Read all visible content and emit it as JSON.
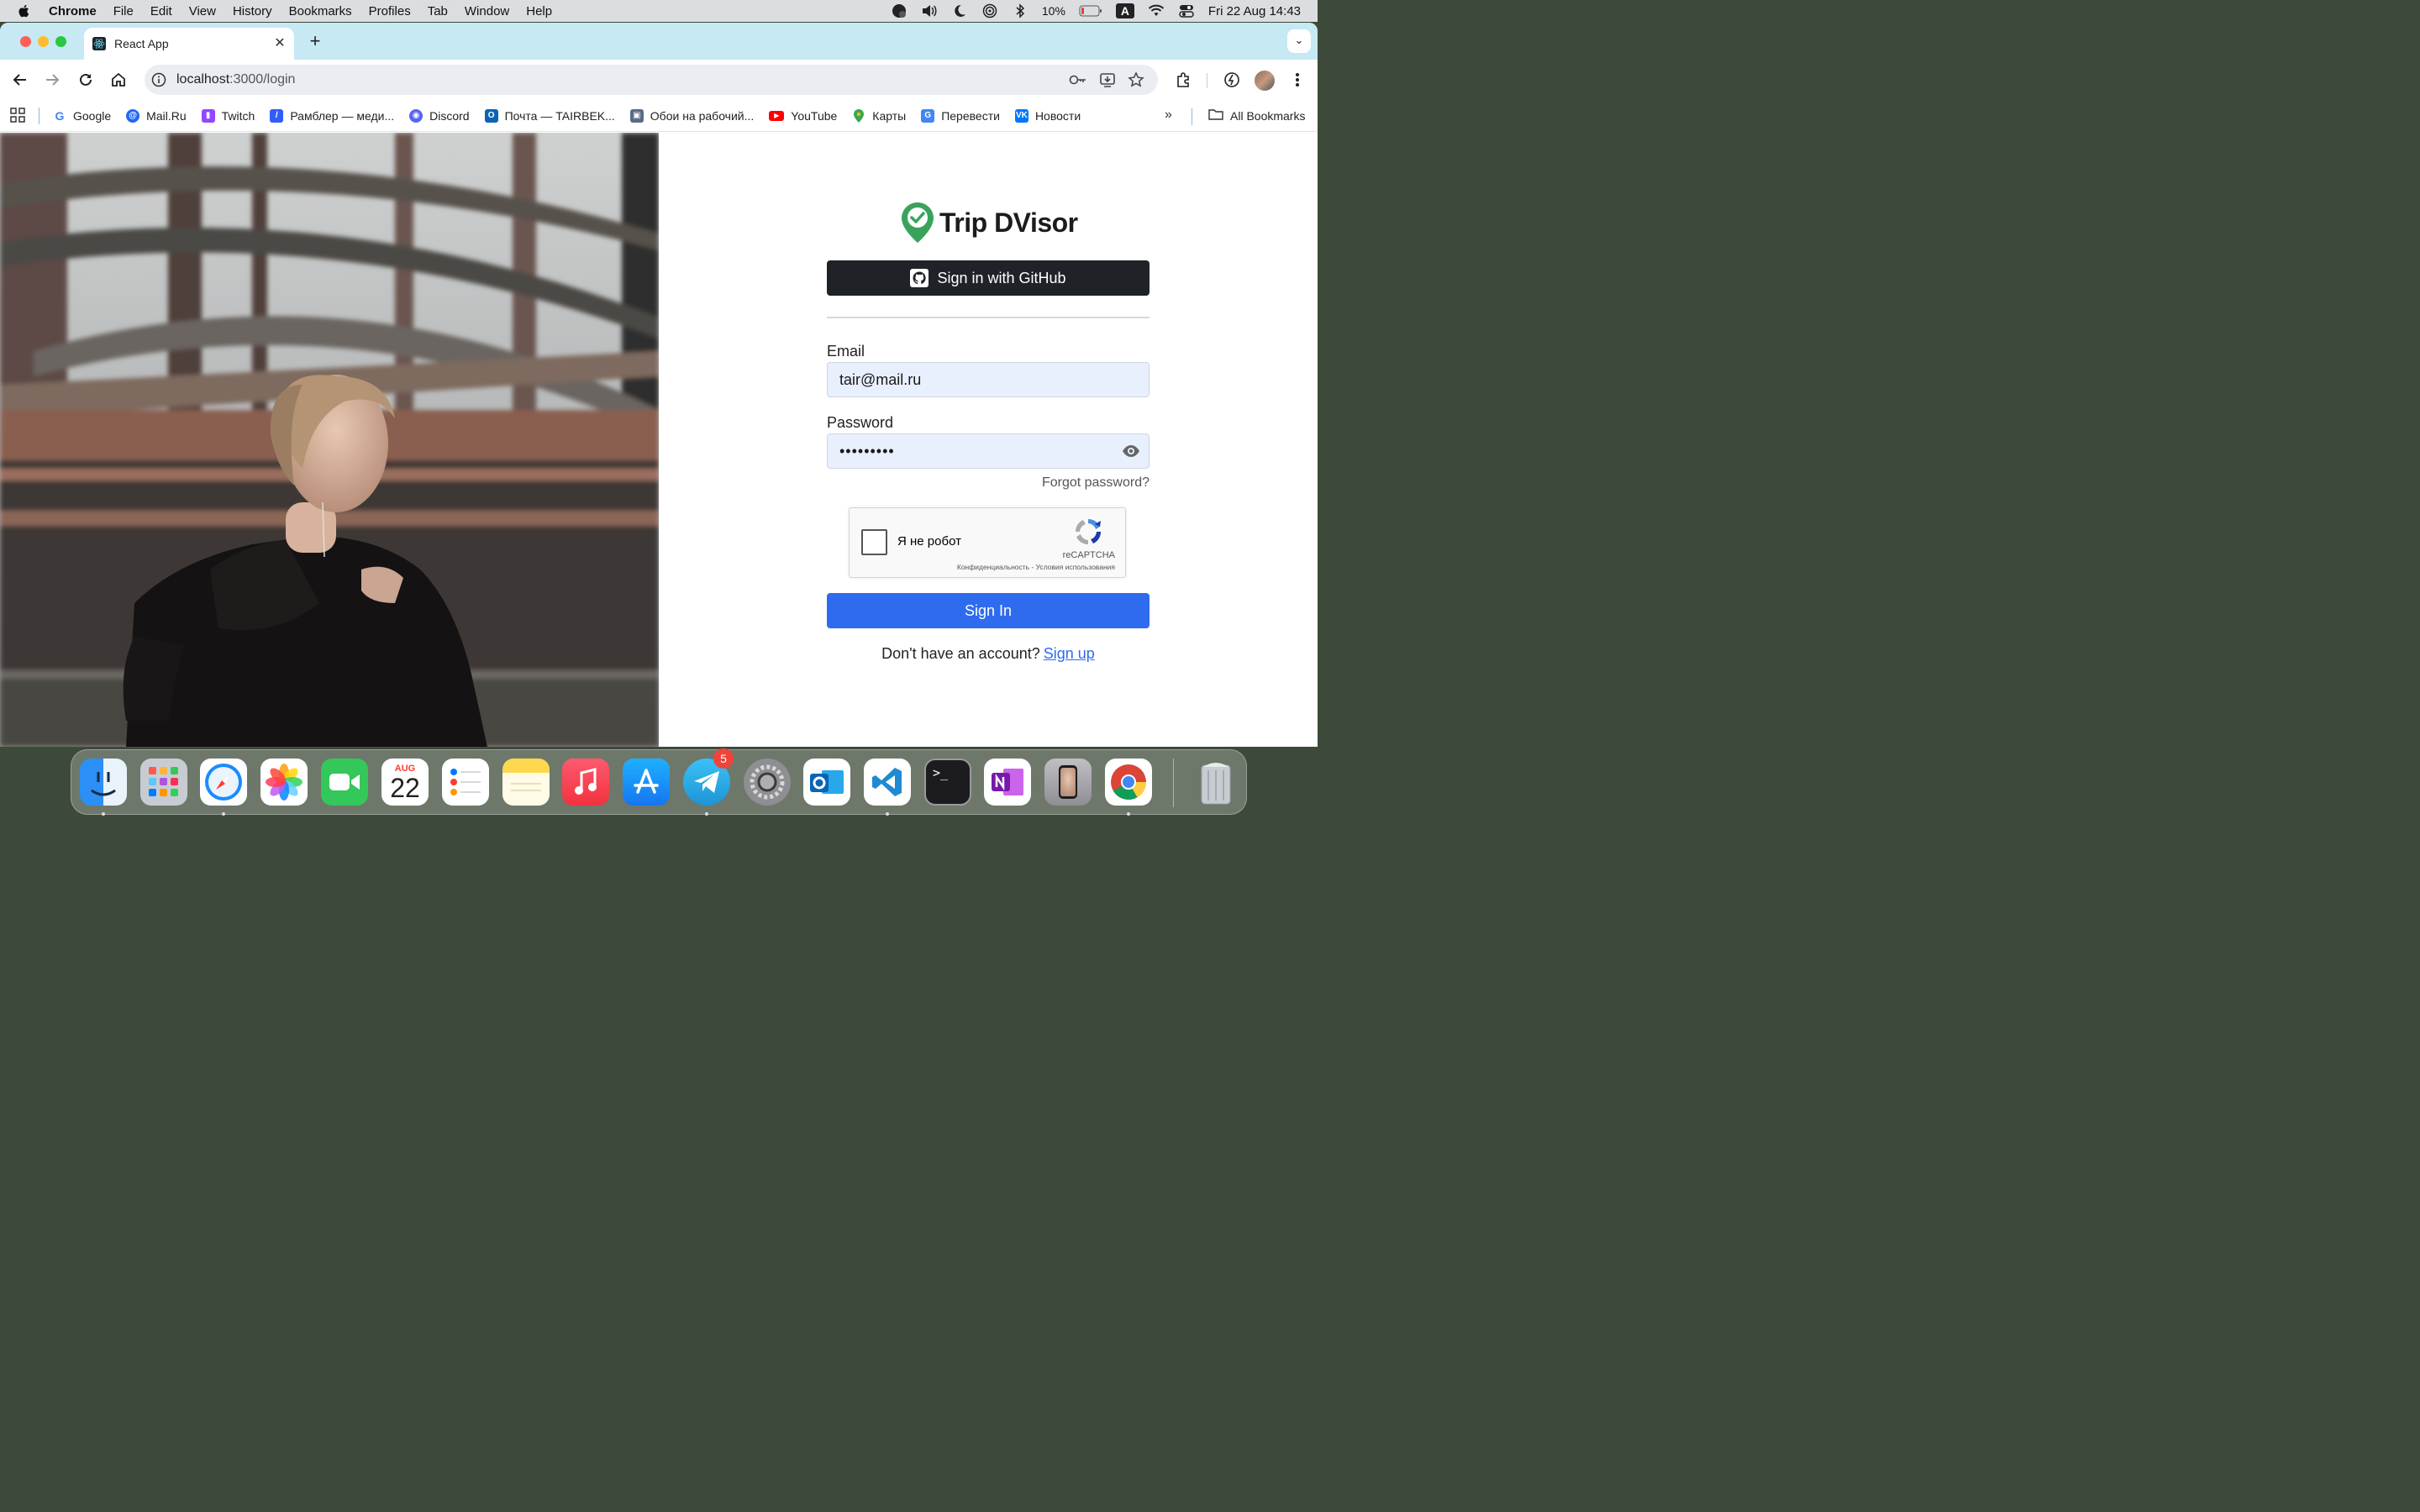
{
  "menubar": {
    "app_name": "Chrome",
    "items": [
      "File",
      "Edit",
      "View",
      "History",
      "Bookmarks",
      "Profiles",
      "Tab",
      "Window",
      "Help"
    ],
    "battery": "10%",
    "input_source": "A",
    "clock": "Fri 22 Aug  14:43"
  },
  "browser": {
    "tab_title": "React App",
    "url_host": "localhost",
    "url_path": ":3000/login",
    "bookmarks": [
      {
        "label": "Google",
        "icon": "google-icon",
        "color": "#4285f4"
      },
      {
        "label": "Mail.Ru",
        "icon": "mailru-icon",
        "color": "#2168f3"
      },
      {
        "label": "Twitch",
        "icon": "twitch-icon",
        "color": "#9146ff"
      },
      {
        "label": "Рамблер — меди...",
        "icon": "rambler-icon",
        "color": "#315efb"
      },
      {
        "label": "Discord",
        "icon": "discord-icon",
        "color": "#5865f2"
      },
      {
        "label": "Почта — TAIRBEK...",
        "icon": "outlook-icon",
        "color": "#0a64b5"
      },
      {
        "label": "Обои на рабочий...",
        "icon": "wallpaper-icon",
        "color": "#5a6a88"
      },
      {
        "label": "YouTube",
        "icon": "youtube-icon",
        "color": "#ff0000"
      },
      {
        "label": "Карты",
        "icon": "maps-icon",
        "color": "#34a853"
      },
      {
        "label": "Перевести",
        "icon": "translate-icon",
        "color": "#4285f4"
      },
      {
        "label": "Новости",
        "icon": "vk-icon",
        "color": "#0077ff"
      }
    ],
    "all_bookmarks": "All Bookmarks"
  },
  "login": {
    "brand": "Trip DVisor",
    "github_button": "Sign in with GitHub",
    "email_label": "Email",
    "email_value": "tair@mail.ru",
    "password_label": "Password",
    "password_value": "•••••••••",
    "forgot_link": "Forgot password?",
    "captcha_label": "Я не робот",
    "captcha_brand": "reCAPTCHA",
    "captcha_terms": "Конфиденциальность - Условия использования",
    "signin_button": "Sign In",
    "signup_prompt": "Don't have an account?",
    "signup_link": "Sign up"
  },
  "dock": {
    "calendar_month": "AUG",
    "calendar_day": "22",
    "telegram_badge": "5",
    "apps": [
      "Finder",
      "Launchpad",
      "Safari",
      "Photos",
      "FaceTime",
      "Calendar",
      "Reminders",
      "Notes",
      "Music",
      "App Store",
      "Telegram",
      "System Settings",
      "Outlook",
      "VS Code",
      "Terminal",
      "OneNote",
      "iPhone Mirroring",
      "Chrome",
      "Trash"
    ]
  },
  "colors": {
    "accent_blue": "#2f6bef",
    "github_dark": "#1f2328",
    "tabstrip": "#c6e9f4",
    "brand_green": "#3aa35b"
  }
}
